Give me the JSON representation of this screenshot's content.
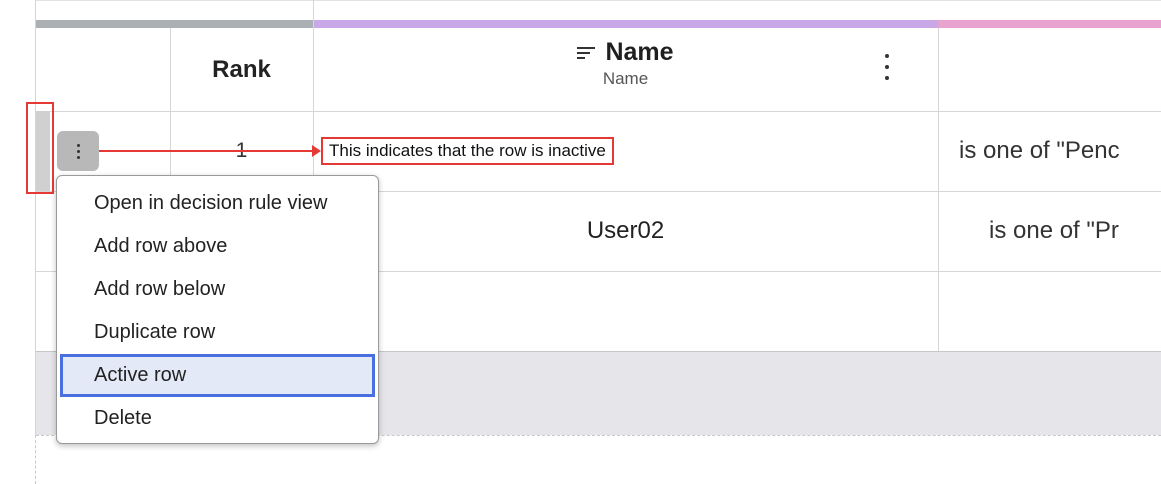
{
  "columns": {
    "rank_header": "Rank",
    "name_header": {
      "title": "Name",
      "subtitle": "Name"
    }
  },
  "rows": [
    {
      "rank": "1",
      "name": "",
      "condition": "is one of \"Penc",
      "inactive": true
    },
    {
      "rank": "",
      "name": "User02",
      "condition": "is one of \"Pr",
      "inactive": false
    }
  ],
  "annotation": {
    "note": "This indicates that the row is inactive",
    "color": "#e53935"
  },
  "context_menu": {
    "items": [
      {
        "label": "Open in decision rule view",
        "highlighted": false
      },
      {
        "label": "Add row above",
        "highlighted": false
      },
      {
        "label": "Add row below",
        "highlighted": false
      },
      {
        "label": "Duplicate row",
        "highlighted": false
      },
      {
        "label": "Active row",
        "highlighted": true
      },
      {
        "label": "Delete",
        "highlighted": false
      }
    ]
  },
  "colors": {
    "rank_bar": "#aab0b4",
    "name_bar": "#c9a8e8",
    "condition_bar": "#e8a3cf",
    "highlight_border": "#4a6fe0",
    "highlight_bg": "#e3e9f6"
  },
  "icons": {
    "sort": "sort-lines-icon",
    "column_menu": "vertical-dots-icon",
    "row_menu": "vertical-dots-icon"
  }
}
